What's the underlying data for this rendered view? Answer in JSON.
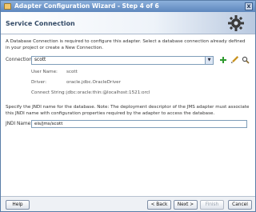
{
  "window": {
    "title": "Adapter Configuration Wizard - Step 4 of 6",
    "close_glyph": "x"
  },
  "header": {
    "title": "Service Connection",
    "icon": "gear-icon"
  },
  "intro": "A Database Connection is required to configure this adapter. Select a database connection already defined in your project or create a New Connection.",
  "connection": {
    "label": "Connection:",
    "value": "scott",
    "actions": [
      "add-icon",
      "edit-icon",
      "search-icon"
    ]
  },
  "details": [
    {
      "name": "User Name:",
      "value": "scott"
    },
    {
      "name": "Driver:",
      "value": "oracle.jdbc.OracleDriver"
    },
    {
      "name": "Connect String:",
      "value": "jdbc:oracle:thin:@localhost:1521:orcl"
    }
  ],
  "jndi_note": "Specify the JNDI name for the database.  Note: The deployment descriptor of the JMS adapter must associate this JNDI name with configuration properties required by the adapter to access the database.",
  "jndi": {
    "label": "JNDI Name:",
    "value": "eis/jms/scott"
  },
  "footer": {
    "help": "Help",
    "back": "< Back",
    "next": "Next >",
    "finish": "Finish",
    "cancel": "Cancel"
  },
  "colors": {
    "titlebar": "#5d86bd",
    "add_icon": "#2e9a2e",
    "edit_icon": "#c8921e"
  }
}
